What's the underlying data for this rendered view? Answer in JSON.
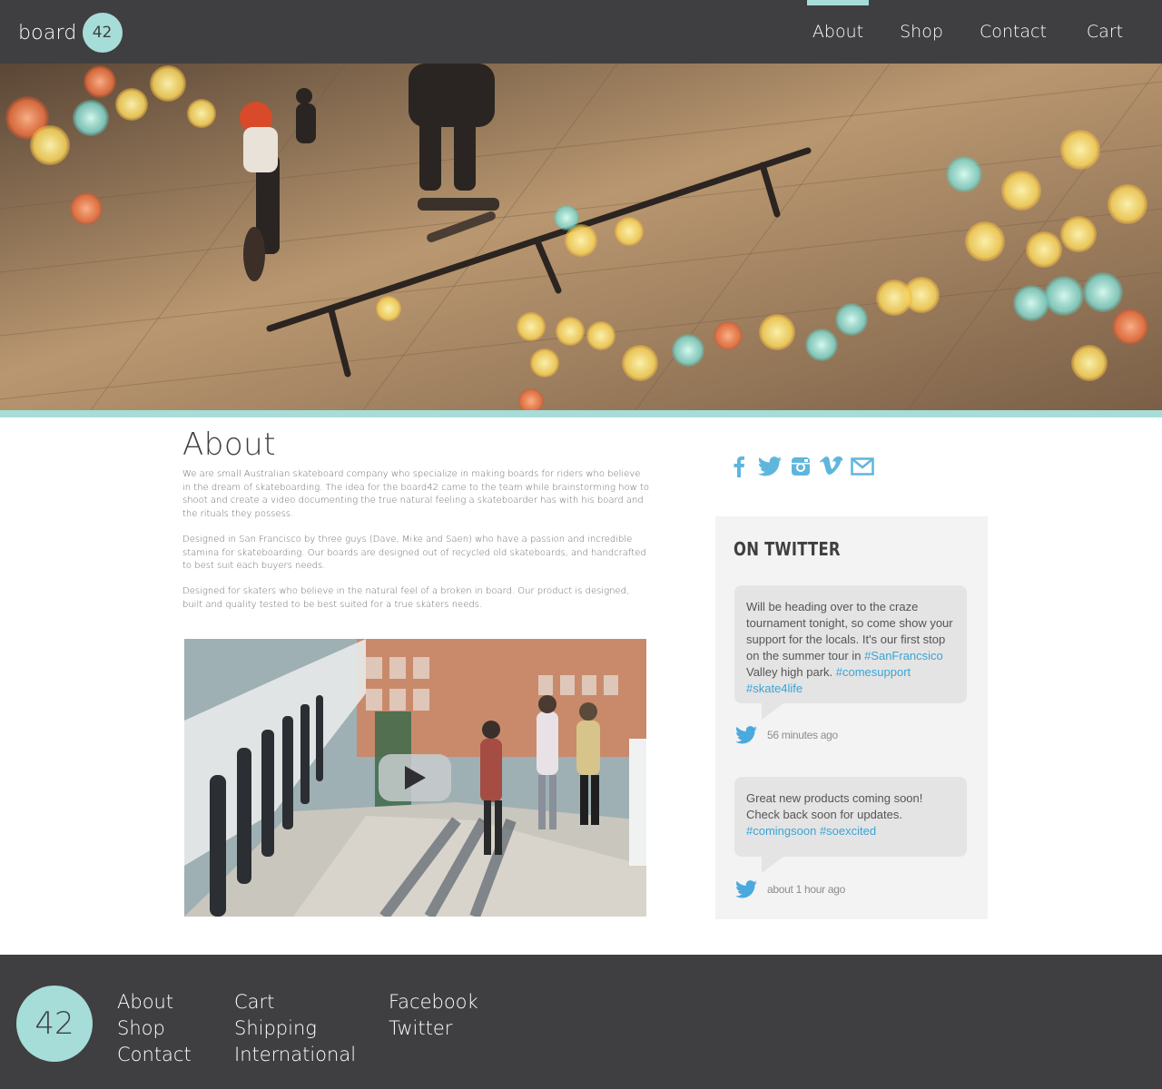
{
  "header": {
    "logo_word": "board",
    "logo_number": "42",
    "nav": [
      {
        "label": "About",
        "active": true
      },
      {
        "label": "Shop",
        "active": false
      },
      {
        "label": "Contact",
        "active": false
      },
      {
        "label": "Cart",
        "active": false
      }
    ]
  },
  "about": {
    "title": "About",
    "paragraphs": [
      "We are small Australian skateboard company who specialize in making boards for riders who believe in the dream of skateboarding. The idea for the board42 came to the team while brainstorming how to shoot and create a video documenting the true natural feeling a skateboarder has with his board and the rituals they possess.",
      "Designed in San Francisco by three guys (Dave, Mike and Saen) who have a passion and incredible stamina for skateboarding. Our boards are designed out of recycled old skateboards, and handcrafted to best suit each buyers needs.",
      "Designed for skaters who believe in the natural feel of a broken in board. Our product is designed, built and quality tested to be best suited for a true skaters needs."
    ]
  },
  "social": {
    "icons": [
      "facebook-icon",
      "twitter-icon",
      "instagram-icon",
      "vimeo-icon",
      "mail-icon"
    ],
    "icon_color": "#5fb6dc"
  },
  "twitter": {
    "title": "ON TWITTER",
    "tweets": [
      {
        "text_before": "Will be heading over to the craze tournament tonight, so come show your support for the locals. It's our first stop on the summer tour in ",
        "tag1": "#SanFrancsico",
        "text_mid": " Valley high park. ",
        "tag2": "#comesupport",
        "tag3": "#skate4life",
        "time": "56 minutes ago"
      },
      {
        "text_before": "Great new products coming soon! Check back soon for updates. ",
        "tag1": "#comingsoon",
        "tag2": "#soexcited",
        "time": "about 1 hour ago"
      }
    ]
  },
  "footer": {
    "badge": "42",
    "col1": [
      "About",
      "Shop",
      "Contact"
    ],
    "col2": [
      "Cart",
      "Shipping",
      "International"
    ],
    "col3": [
      "Facebook",
      "Twitter"
    ]
  },
  "colors": {
    "dark": "#3f3f42",
    "accent": "#a6ddd8",
    "link": "#3aa4d6"
  }
}
